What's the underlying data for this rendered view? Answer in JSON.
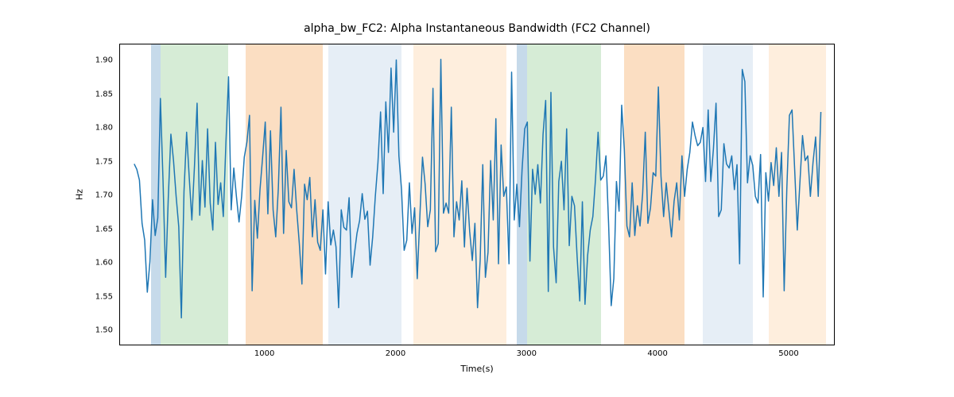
{
  "chart_data": {
    "type": "line",
    "title": "alpha_bw_FC2: Alpha Instantaneous Bandwidth (FC2 Channel)",
    "xlabel": "Time(s)",
    "ylabel": "Hz",
    "xlim": [
      -108,
      5352
    ],
    "ylim": [
      1.478,
      1.925
    ],
    "xticks": [
      1000,
      2000,
      3000,
      4000,
      5000
    ],
    "yticks": [
      1.5,
      1.55,
      1.6,
      1.65,
      1.7,
      1.75,
      1.8,
      1.85,
      1.9
    ],
    "bands": [
      {
        "x0": 130,
        "x1": 200,
        "color": "#a8c6df",
        "alpha": 0.65
      },
      {
        "x0": 200,
        "x1": 720,
        "color": "#b4ddb4",
        "alpha": 0.55
      },
      {
        "x0": 850,
        "x1": 1440,
        "color": "#f7c38f",
        "alpha": 0.55
      },
      {
        "x0": 1480,
        "x1": 2040,
        "color": "#d5e3f0",
        "alpha": 0.6
      },
      {
        "x0": 2130,
        "x1": 2840,
        "color": "#fde3c7",
        "alpha": 0.6
      },
      {
        "x0": 2920,
        "x1": 3000,
        "color": "#a8c6df",
        "alpha": 0.65
      },
      {
        "x0": 3000,
        "x1": 3560,
        "color": "#b4ddb4",
        "alpha": 0.55
      },
      {
        "x0": 3740,
        "x1": 4200,
        "color": "#f7c38f",
        "alpha": 0.55
      },
      {
        "x0": 4340,
        "x1": 4720,
        "color": "#d5e3f0",
        "alpha": 0.6
      },
      {
        "x0": 4840,
        "x1": 5280,
        "color": "#fde3c7",
        "alpha": 0.6
      }
    ],
    "x": [
      0,
      20,
      40,
      60,
      80,
      100,
      120,
      140,
      160,
      180,
      200,
      220,
      240,
      260,
      280,
      300,
      320,
      340,
      360,
      380,
      400,
      420,
      440,
      460,
      480,
      500,
      520,
      540,
      560,
      580,
      600,
      620,
      640,
      660,
      680,
      700,
      720,
      740,
      760,
      780,
      800,
      820,
      840,
      860,
      880,
      900,
      920,
      940,
      960,
      980,
      1000,
      1020,
      1040,
      1060,
      1080,
      1100,
      1120,
      1140,
      1160,
      1180,
      1200,
      1220,
      1240,
      1260,
      1280,
      1300,
      1320,
      1340,
      1360,
      1380,
      1400,
      1420,
      1440,
      1460,
      1480,
      1500,
      1520,
      1540,
      1560,
      1580,
      1600,
      1620,
      1640,
      1660,
      1680,
      1700,
      1720,
      1740,
      1760,
      1780,
      1800,
      1820,
      1840,
      1860,
      1880,
      1900,
      1920,
      1940,
      1960,
      1980,
      2000,
      2020,
      2040,
      2060,
      2080,
      2100,
      2120,
      2140,
      2160,
      2180,
      2200,
      2220,
      2240,
      2260,
      2280,
      2300,
      2320,
      2340,
      2360,
      2380,
      2400,
      2420,
      2440,
      2460,
      2480,
      2500,
      2520,
      2540,
      2560,
      2580,
      2600,
      2620,
      2640,
      2660,
      2680,
      2700,
      2720,
      2740,
      2760,
      2780,
      2800,
      2820,
      2840,
      2860,
      2880,
      2900,
      2920,
      2940,
      2960,
      2980,
      3000,
      3020,
      3040,
      3060,
      3080,
      3100,
      3120,
      3140,
      3160,
      3180,
      3200,
      3220,
      3240,
      3260,
      3280,
      3300,
      3320,
      3340,
      3360,
      3380,
      3400,
      3420,
      3440,
      3460,
      3480,
      3500,
      3520,
      3540,
      3560,
      3580,
      3600,
      3620,
      3640,
      3660,
      3680,
      3700,
      3720,
      3740,
      3760,
      3780,
      3800,
      3820,
      3840,
      3860,
      3880,
      3900,
      3920,
      3940,
      3960,
      3980,
      4000,
      4020,
      4040,
      4060,
      4080,
      4100,
      4120,
      4140,
      4160,
      4180,
      4200,
      4220,
      4240,
      4260,
      4280,
      4300,
      4320,
      4340,
      4360,
      4380,
      4400,
      4420,
      4440,
      4460,
      4480,
      4500,
      4520,
      4540,
      4560,
      4580,
      4600,
      4620,
      4640,
      4660,
      4680,
      4700,
      4720,
      4740,
      4760,
      4780,
      4800,
      4820,
      4840,
      4860,
      4880,
      4900,
      4920,
      4940,
      4960,
      4980,
      5000,
      5020,
      5040,
      5060,
      5080,
      5100,
      5120,
      5140,
      5160,
      5180,
      5200,
      5220,
      5240
    ],
    "values": [
      1.748,
      1.74,
      1.724,
      1.66,
      1.635,
      1.558,
      1.603,
      1.695,
      1.642,
      1.668,
      1.845,
      1.723,
      1.58,
      1.697,
      1.792,
      1.753,
      1.7,
      1.655,
      1.52,
      1.707,
      1.795,
      1.728,
      1.665,
      1.745,
      1.838,
      1.672,
      1.753,
      1.684,
      1.8,
      1.69,
      1.65,
      1.78,
      1.688,
      1.72,
      1.67,
      1.78,
      1.877,
      1.68,
      1.742,
      1.7,
      1.662,
      1.7,
      1.758,
      1.78,
      1.82,
      1.56,
      1.694,
      1.638,
      1.71,
      1.758,
      1.81,
      1.674,
      1.797,
      1.68,
      1.64,
      1.712,
      1.832,
      1.645,
      1.768,
      1.692,
      1.683,
      1.74,
      1.68,
      1.63,
      1.57,
      1.718,
      1.695,
      1.728,
      1.64,
      1.695,
      1.632,
      1.62,
      1.68,
      1.585,
      1.692,
      1.628,
      1.65,
      1.625,
      1.535,
      1.68,
      1.654,
      1.65,
      1.698,
      1.58,
      1.614,
      1.645,
      1.664,
      1.704,
      1.666,
      1.678,
      1.598,
      1.64,
      1.7,
      1.75,
      1.825,
      1.704,
      1.84,
      1.765,
      1.89,
      1.795,
      1.902,
      1.76,
      1.71,
      1.62,
      1.635,
      1.72,
      1.645,
      1.683,
      1.578,
      1.671,
      1.758,
      1.718,
      1.655,
      1.68,
      1.86,
      1.618,
      1.63,
      1.903,
      1.675,
      1.69,
      1.675,
      1.832,
      1.64,
      1.692,
      1.665,
      1.723,
      1.625,
      1.712,
      1.648,
      1.605,
      1.66,
      1.535,
      1.605,
      1.747,
      1.58,
      1.617,
      1.753,
      1.665,
      1.815,
      1.6,
      1.776,
      1.7,
      1.714,
      1.6,
      1.884,
      1.665,
      1.718,
      1.655,
      1.74,
      1.8,
      1.81,
      1.604,
      1.74,
      1.703,
      1.747,
      1.69,
      1.792,
      1.842,
      1.559,
      1.854,
      1.625,
      1.572,
      1.722,
      1.752,
      1.68,
      1.8,
      1.627,
      1.7,
      1.686,
      1.61,
      1.545,
      1.692,
      1.54,
      1.612,
      1.65,
      1.67,
      1.725,
      1.795,
      1.724,
      1.73,
      1.76,
      1.66,
      1.538,
      1.578,
      1.722,
      1.678,
      1.835,
      1.77,
      1.656,
      1.64,
      1.72,
      1.642,
      1.686,
      1.656,
      1.704,
      1.795,
      1.66,
      1.683,
      1.735,
      1.73,
      1.862,
      1.73,
      1.67,
      1.72,
      1.68,
      1.64,
      1.693,
      1.72,
      1.665,
      1.76,
      1.7,
      1.74,
      1.765,
      1.81,
      1.79,
      1.775,
      1.78,
      1.802,
      1.722,
      1.828,
      1.722,
      1.77,
      1.838,
      1.67,
      1.68,
      1.778,
      1.748,
      1.742,
      1.76,
      1.71,
      1.747,
      1.6,
      1.888,
      1.87,
      1.72,
      1.76,
      1.746,
      1.7,
      1.69,
      1.762,
      1.551,
      1.735,
      1.693,
      1.75,
      1.716,
      1.772,
      1.7,
      1.765,
      1.56,
      1.71,
      1.82,
      1.828,
      1.74,
      1.65,
      1.72,
      1.79,
      1.753,
      1.76,
      1.7,
      1.75,
      1.788,
      1.7,
      1.825
    ]
  }
}
